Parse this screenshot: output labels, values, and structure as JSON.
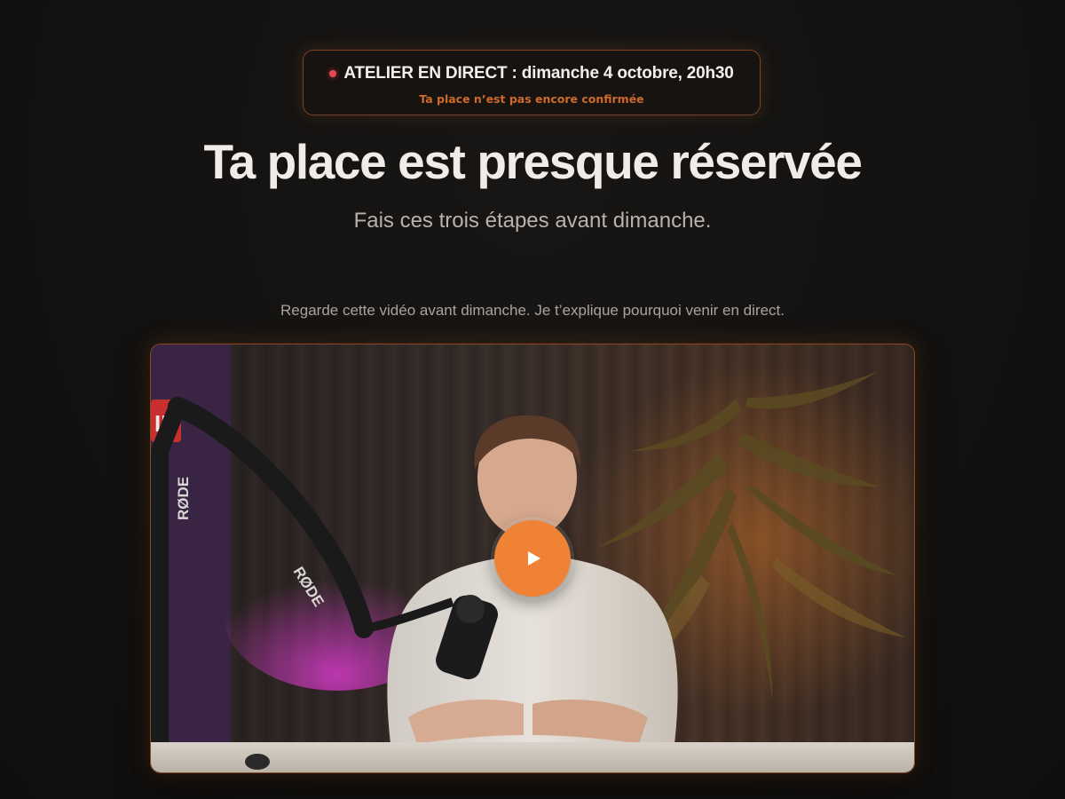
{
  "badge": {
    "title": "ATELIER EN DIRECT : dimanche 4 octobre, 20h30",
    "status": "Ta place n’est pas encore confirmée",
    "dot_icon": "live-dot-icon",
    "dot_color": "#e5484d"
  },
  "hero": {
    "title": "Ta place est presque réservée",
    "subtitle": "Fais ces trois étapes avant dimanche."
  },
  "video": {
    "caption": "Regarde cette vidéo avant dimanche. Je t’explique pourquoi venir en direct.",
    "mic_brand": "RØDE",
    "sign_text": "IR",
    "play_icon": "play-icon",
    "accent_color": "#f08236"
  }
}
